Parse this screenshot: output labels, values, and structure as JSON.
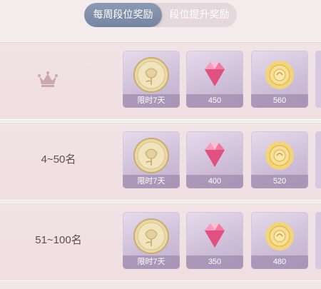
{
  "tabs": [
    {
      "label": "每周段位奖励",
      "active": true
    },
    {
      "label": "段位提升奖励",
      "active": false
    }
  ],
  "rows": [
    {
      "rank": "",
      "rank_icon": "crown-icon",
      "rewards": [
        {
          "icon": "gold-rose-coin-icon",
          "caption": "限时7天"
        },
        {
          "icon": "pink-diamond-icon",
          "caption": "450"
        },
        {
          "icon": "gold-rose-icon",
          "caption": "560"
        }
      ]
    },
    {
      "rank": "4~50名",
      "rewards": [
        {
          "icon": "gold-rose-coin-icon",
          "caption": "限时7天"
        },
        {
          "icon": "pink-diamond-icon",
          "caption": "400"
        },
        {
          "icon": "gold-rose-icon",
          "caption": "520"
        }
      ]
    },
    {
      "rank": "51~100名",
      "rewards": [
        {
          "icon": "gold-rose-coin-icon",
          "caption": "限时7天"
        },
        {
          "icon": "pink-diamond-icon",
          "caption": "350"
        },
        {
          "icon": "gold-rose-icon",
          "caption": "480"
        }
      ]
    }
  ],
  "colors": {
    "active_tab": "#7f8daa",
    "row_bg": "#f0e0e4",
    "card_bg": "#d3c3dc"
  }
}
